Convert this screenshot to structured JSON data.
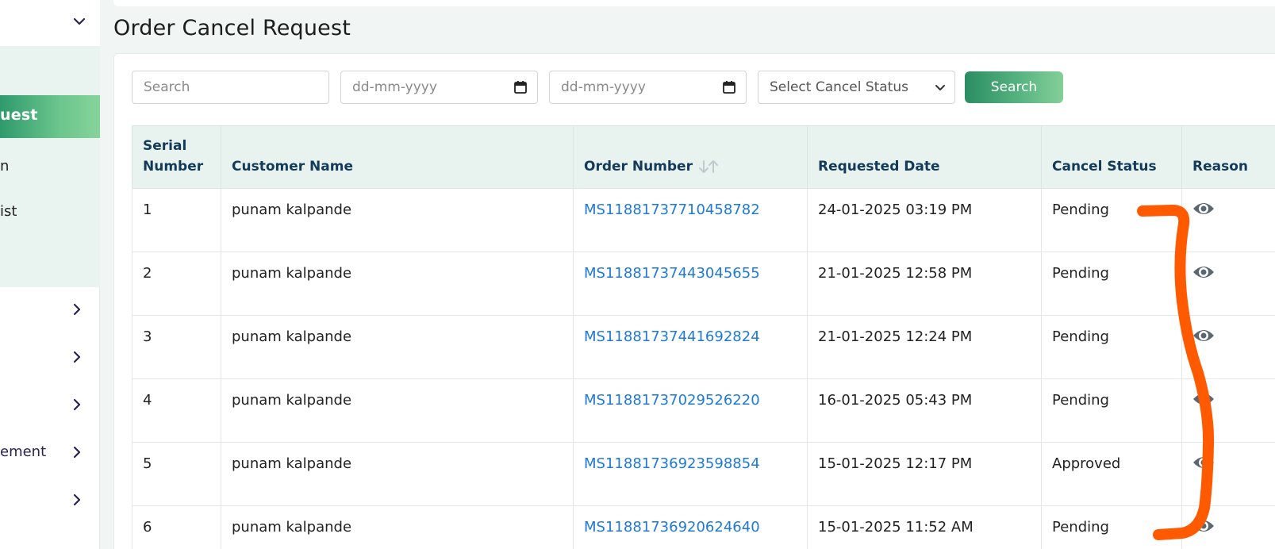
{
  "sidebar": {
    "sub_items": [
      "uest",
      "n",
      "ist"
    ],
    "nav_items": [
      "",
      "",
      "",
      "ement",
      ""
    ]
  },
  "page": {
    "title": "Order Cancel Request"
  },
  "filters": {
    "search_placeholder": "Search",
    "from_date_placeholder": "dd-mm-yyyy",
    "to_date_placeholder": "dd-mm-yyyy",
    "status_select": "Select Cancel Status",
    "search_button": "Search"
  },
  "table": {
    "headers": {
      "serial_line1": "Serial",
      "serial_line2": "Number",
      "customer": "Customer Name",
      "order": "Order Number",
      "requested": "Requested Date",
      "status": "Cancel Status",
      "reason": "Reason"
    },
    "rows": [
      {
        "serial": "1",
        "customer": "punam kalpande",
        "order": "MS11881737710458782",
        "date": "24-01-2025 03:19 PM",
        "status": "Pending"
      },
      {
        "serial": "2",
        "customer": "punam kalpande",
        "order": "MS11881737443045655",
        "date": "21-01-2025 12:58 PM",
        "status": "Pending"
      },
      {
        "serial": "3",
        "customer": "punam kalpande",
        "order": "MS11881737441692824",
        "date": "21-01-2025 12:24 PM",
        "status": "Pending"
      },
      {
        "serial": "4",
        "customer": "punam kalpande",
        "order": "MS11881737029526220",
        "date": "16-01-2025 05:43 PM",
        "status": "Pending"
      },
      {
        "serial": "5",
        "customer": "punam kalpande",
        "order": "MS11881736923598854",
        "date": "15-01-2025 12:17 PM",
        "status": "Approved"
      },
      {
        "serial": "6",
        "customer": "punam kalpande",
        "order": "MS11881736920624640",
        "date": "15-01-2025 11:52 AM",
        "status": "Pending"
      }
    ]
  },
  "colors": {
    "accent": "#2e9a6c",
    "link": "#1d7ad8",
    "annotation": "#ff5a00"
  }
}
